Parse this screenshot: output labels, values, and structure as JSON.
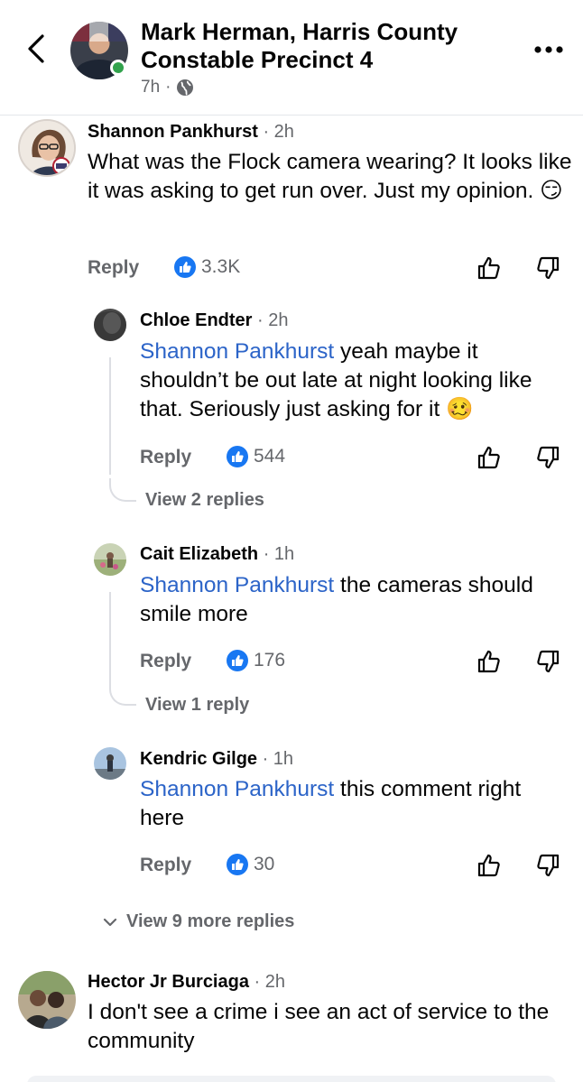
{
  "header": {
    "page_name": "Mark Herman, Harris County Constable Precinct 4",
    "time": "7h",
    "separator": "·",
    "audience_icon": "globe-icon",
    "back_icon": "chevron-left-icon",
    "more_icon": "more-horizontal-icon"
  },
  "colors": {
    "mention": "#2c64c8",
    "like": "#1877f2",
    "online": "#31a24c",
    "muted": "#65676b"
  },
  "comments": [
    {
      "author": "Shannon Pankhurst",
      "time": "· 2h",
      "text": "What was the Flock camera wearing? It looks like it was asking to get run over. Just my opinion. 😏",
      "reply_label": "Reply",
      "likes": "3.3K",
      "replies": [
        {
          "author": "Chloe Endter",
          "time": "· 2h",
          "mention": "Shannon Pankhurst",
          "text": " yeah maybe it shouldn’t be out late at night looking like that. Seriously just asking for it 🥴",
          "reply_label": "Reply",
          "likes": "544",
          "view_replies": "View 2 replies"
        },
        {
          "author": "Cait Elizabeth",
          "time": "· 1h",
          "mention": "Shannon Pankhurst",
          "text": " the cameras should smile more",
          "reply_label": "Reply",
          "likes": "176",
          "view_replies": "View 1 reply"
        },
        {
          "author": "Kendric Gilge",
          "time": "· 1h",
          "mention": "Shannon Pankhurst",
          "text": " this comment right here",
          "reply_label": "Reply",
          "likes": "30"
        }
      ],
      "view_more": "View 9 more replies"
    },
    {
      "author": "Hector Jr Burciaga",
      "time": "· 2h",
      "text": "I don't see a crime i see an act of service to the community"
    }
  ]
}
